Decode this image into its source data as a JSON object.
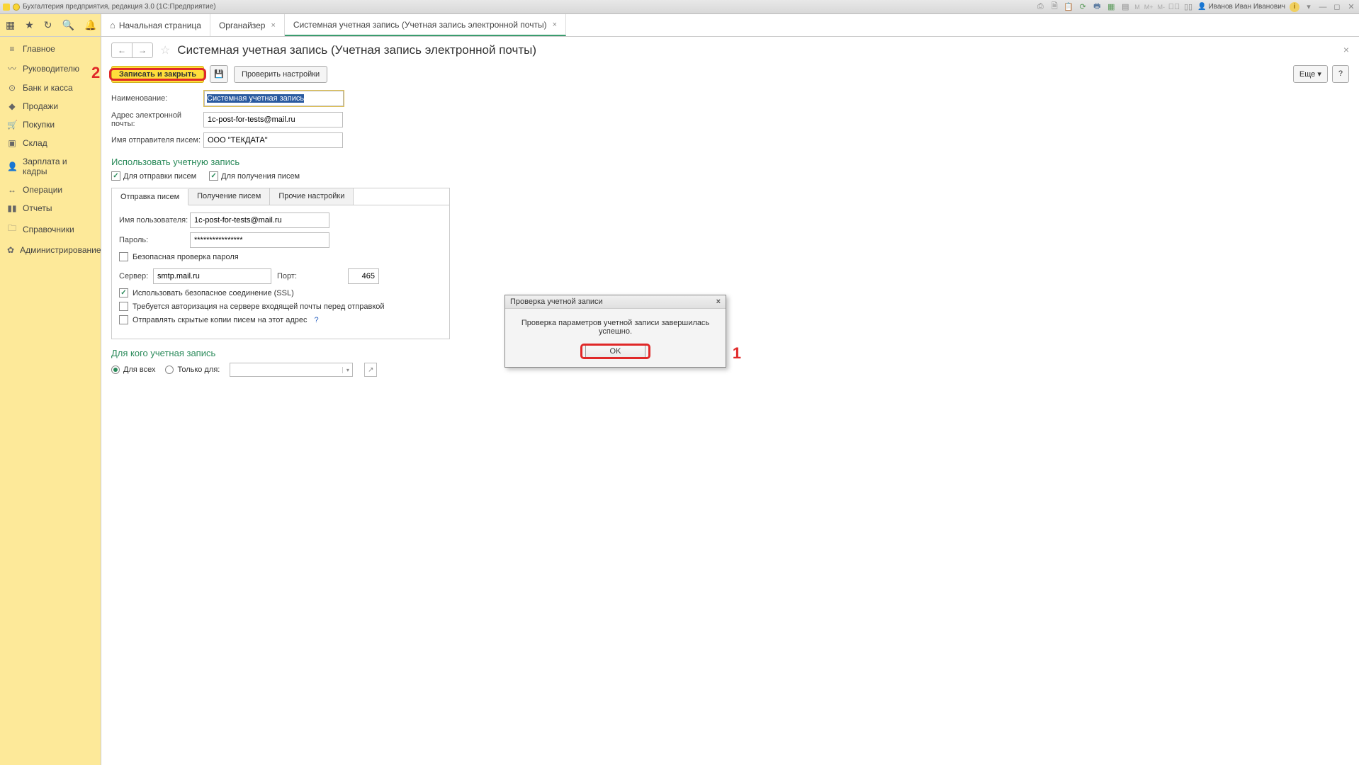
{
  "titlebar": {
    "title": "Бухгалтерия предприятия, редакция 3.0  (1С:Предприятие)",
    "m_labels": [
      "M",
      "M+",
      "M-"
    ],
    "user": "Иванов Иван Иванович"
  },
  "tabs": {
    "home": "Начальная страница",
    "org": "Органайзер",
    "sys": "Системная учетная запись (Учетная запись электронной почты)"
  },
  "sidebar": [
    "Главное",
    "Руководителю",
    "Банк и касса",
    "Продажи",
    "Покупки",
    "Склад",
    "Зарплата и кадры",
    "Операции",
    "Отчеты",
    "Справочники",
    "Администрирование"
  ],
  "page": {
    "title": "Системная учетная запись (Учетная запись электронной почты)",
    "save_close": "Записать и закрыть",
    "check_settings": "Проверить настройки",
    "more": "Еще",
    "help": "?",
    "annot2": "2"
  },
  "form": {
    "name_label": "Наименование:",
    "name_value": "Системная учетная запись",
    "email_label": "Адрес электронной почты:",
    "email_value": "1c-post-for-tests@mail.ru",
    "sender_label": "Имя отправителя писем:",
    "sender_value": "ООО \"ТЕКДАТА\""
  },
  "use_section": {
    "heading": "Использовать учетную запись",
    "for_send": "Для отправки писем",
    "for_recv": "Для получения писем"
  },
  "inner_tabs": {
    "send": "Отправка писем",
    "recv": "Получение писем",
    "other": "Прочие настройки"
  },
  "smtp": {
    "user_label": "Имя пользователя:",
    "user_value": "1c-post-for-tests@mail.ru",
    "pass_label": "Пароль:",
    "pass_value": "****************",
    "safe_check": "Безопасная проверка пароля",
    "server_label": "Сервер:",
    "server_value": "smtp.mail.ru",
    "port_label": "Порт:",
    "port_value": "465",
    "ssl": "Использовать безопасное соединение (SSL)",
    "auth_before": "Требуется авторизация на сервере входящей почты перед отправкой",
    "bcc": "Отправлять скрытые копии писем на этот адрес"
  },
  "who": {
    "heading": "Для кого учетная запись",
    "all": "Для всех",
    "only": "Только для:"
  },
  "modal": {
    "title": "Проверка учетной записи",
    "message": "Проверка параметров учетной записи завершилась успешно.",
    "ok": "OK",
    "annot1": "1"
  }
}
